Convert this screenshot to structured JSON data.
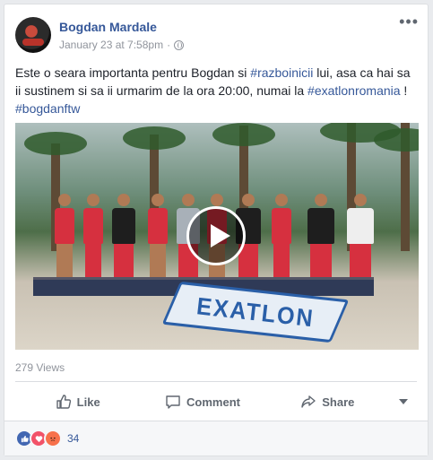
{
  "post": {
    "author": "Bogdan Mardale",
    "timestamp": "January 23 at 7:58pm",
    "separator": "·",
    "privacy_icon": "globe-icon",
    "more_icon": "more-options-icon",
    "more_label": "•••",
    "text_parts": {
      "p1": "Este o seara importanta pentru Bogdan si ",
      "tag1": "#razboinicii",
      "p2": " lui, asa ca hai sa ii sustinem si sa ii urmarim de la ora 20:00, numai la ",
      "tag2": "#exatlonromania",
      "p3": " !",
      "tag3": "#bogdanftw"
    },
    "video": {
      "play_icon": "play-icon",
      "logo_text": "EXATLON"
    },
    "views": "279 Views"
  },
  "actions": {
    "like": "Like",
    "comment": "Comment",
    "share": "Share"
  },
  "reactions": {
    "types": [
      "like",
      "love",
      "angry"
    ],
    "count": "34"
  },
  "colors": {
    "link": "#365899",
    "muted": "#90949c",
    "action": "#606770",
    "background": "#e9ebee"
  }
}
